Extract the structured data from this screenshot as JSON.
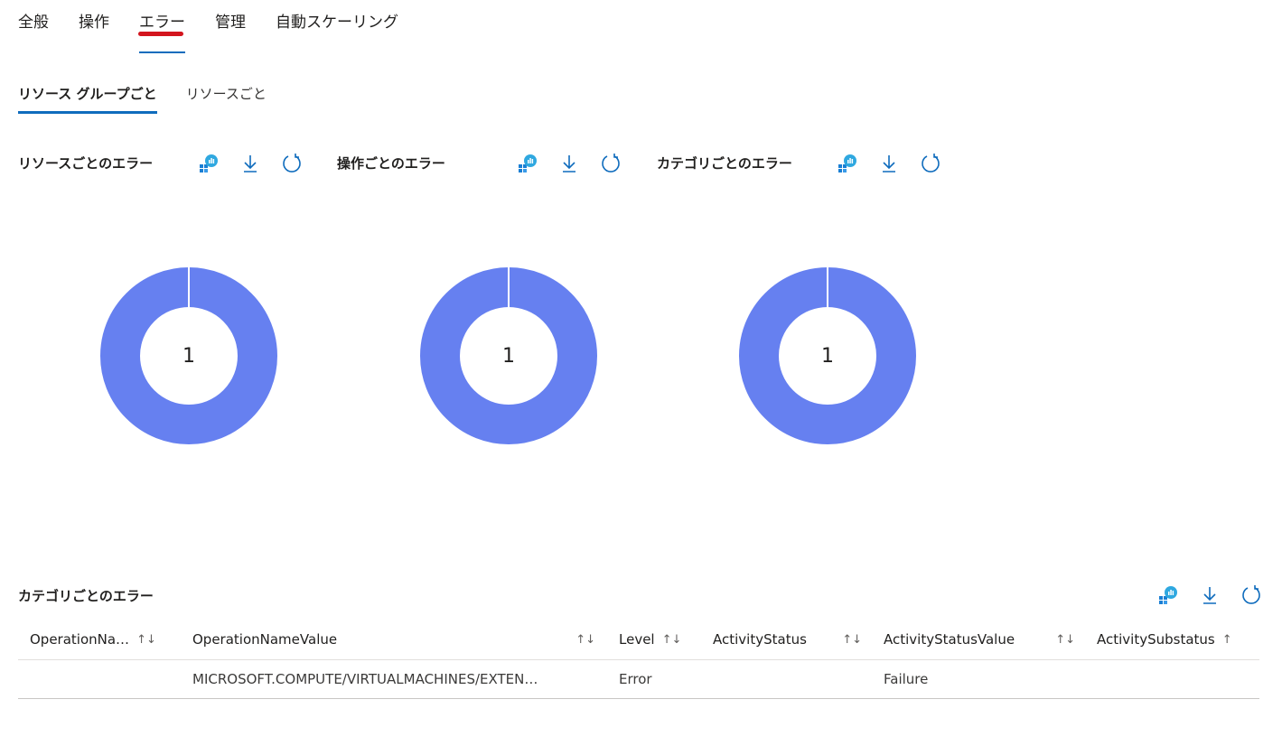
{
  "top_tabs": [
    "全般",
    "操作",
    "エラー",
    "管理",
    "自動スケーリング"
  ],
  "sub_tabs": [
    "リソース グループごと",
    "リソースごと"
  ],
  "panels": [
    {
      "title": "リソースごとのエラー",
      "value": "1"
    },
    {
      "title": "操作ごとのエラー",
      "value": "1"
    },
    {
      "title": "カテゴリごとのエラー",
      "value": "1"
    }
  ],
  "table": {
    "title": "カテゴリごとのエラー",
    "columns": [
      "OperationNa…",
      "OperationNameValue",
      "Level",
      "ActivityStatus",
      "ActivityStatusValue",
      "ActivitySubstatus"
    ],
    "rows": [
      [
        "",
        "MICROSOFT.COMPUTE/VIRTUALMACHINES/EXTEN…",
        "Error",
        "",
        "Failure",
        ""
      ]
    ]
  },
  "icons": {
    "insights": "insights-icon",
    "download": "download-icon",
    "refresh": "refresh-icon",
    "sort": "↑↓"
  },
  "colors": {
    "donut": "#6680f0",
    "accent": "#0f6cbd",
    "annotation": "#d3151e"
  }
}
